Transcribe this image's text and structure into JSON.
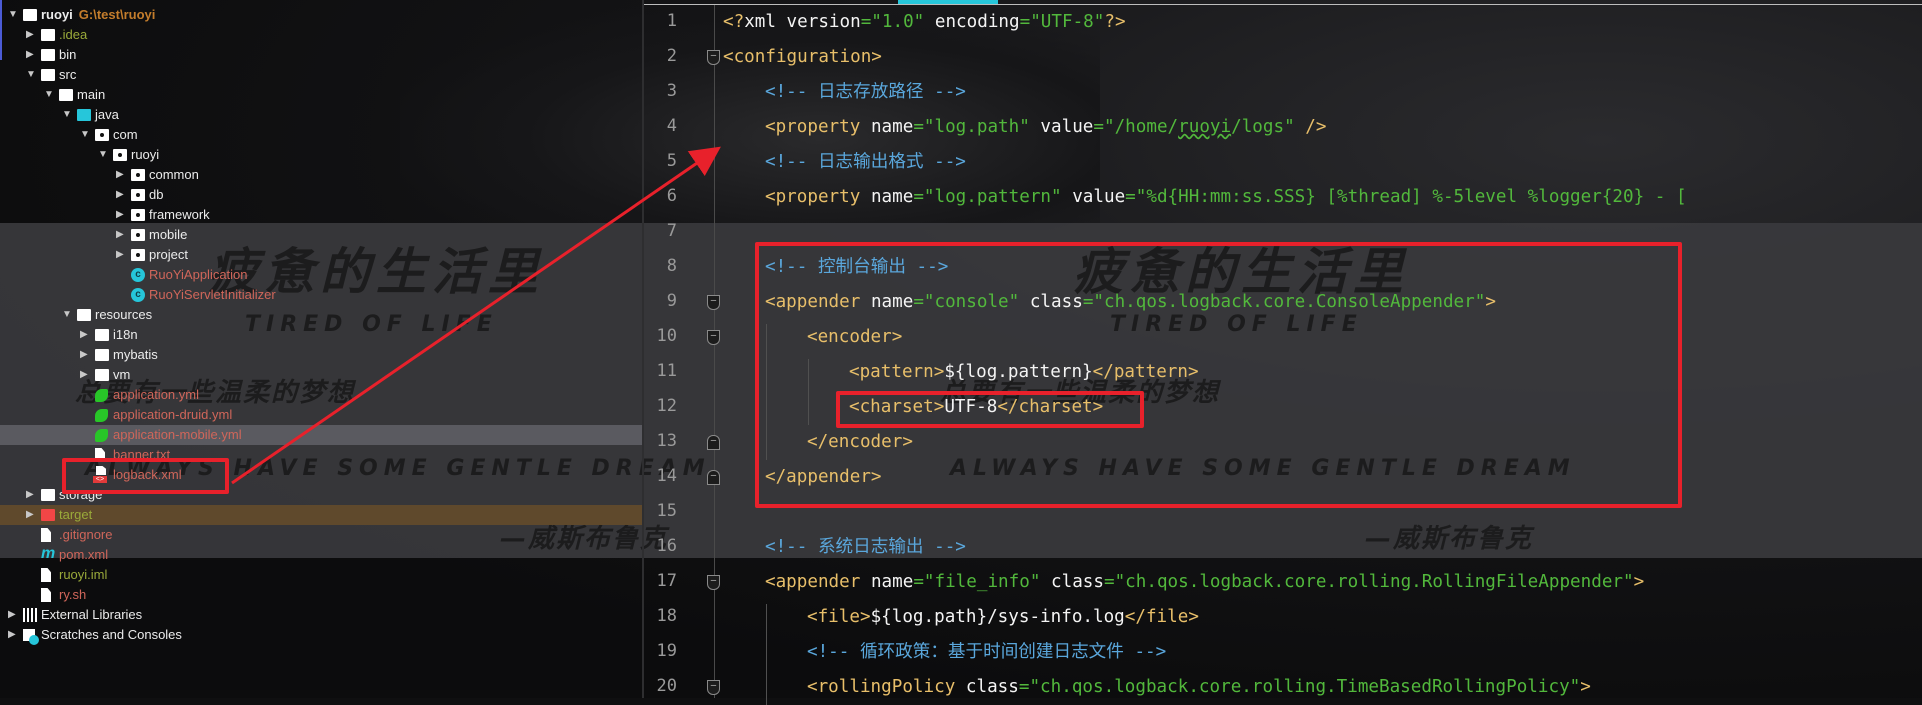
{
  "project_tree": {
    "rows": [
      {
        "label": "ruoyi",
        "extra": "G:\\test\\ruoyi",
        "level": 0,
        "arrow": "down",
        "icon": "module-folder",
        "color": "white",
        "bold": true
      },
      {
        "label": ".idea",
        "level": 1,
        "arrow": "right",
        "icon": "folder",
        "color": "olive"
      },
      {
        "label": "bin",
        "level": 1,
        "arrow": "right",
        "icon": "folder",
        "color": "white"
      },
      {
        "label": "src",
        "level": 1,
        "arrow": "down",
        "icon": "folder",
        "color": "white"
      },
      {
        "label": "main",
        "level": 2,
        "arrow": "down",
        "icon": "folder",
        "color": "white"
      },
      {
        "label": "java",
        "level": 3,
        "arrow": "down",
        "icon": "source-folder",
        "color": "white"
      },
      {
        "label": "com",
        "level": 4,
        "arrow": "down",
        "icon": "package",
        "color": "white"
      },
      {
        "label": "ruoyi",
        "level": 5,
        "arrow": "down",
        "icon": "package",
        "color": "white"
      },
      {
        "label": "common",
        "level": 6,
        "arrow": "right",
        "icon": "package",
        "color": "white"
      },
      {
        "label": "db",
        "level": 6,
        "arrow": "right",
        "icon": "package",
        "color": "white"
      },
      {
        "label": "framework",
        "level": 6,
        "arrow": "right",
        "icon": "package",
        "color": "white"
      },
      {
        "label": "mobile",
        "level": 6,
        "arrow": "right",
        "icon": "package",
        "color": "white"
      },
      {
        "label": "project",
        "level": 6,
        "arrow": "right",
        "icon": "package",
        "color": "white"
      },
      {
        "label": "RuoYiApplication",
        "level": 6,
        "arrow": "none",
        "icon": "spring-class",
        "color": "red"
      },
      {
        "label": "RuoYiServletInitializer",
        "level": 6,
        "arrow": "none",
        "icon": "class",
        "color": "red"
      },
      {
        "label": "resources",
        "level": 3,
        "arrow": "down",
        "icon": "resources-folder",
        "color": "white"
      },
      {
        "label": "i18n",
        "level": 4,
        "arrow": "right",
        "icon": "folder",
        "color": "white"
      },
      {
        "label": "mybatis",
        "level": 4,
        "arrow": "right",
        "icon": "folder",
        "color": "white"
      },
      {
        "label": "vm",
        "level": 4,
        "arrow": "right",
        "icon": "folder",
        "color": "white"
      },
      {
        "label": "application.yml",
        "level": 4,
        "arrow": "none",
        "icon": "yml",
        "color": "red"
      },
      {
        "label": "application-druid.yml",
        "level": 4,
        "arrow": "none",
        "icon": "yml",
        "color": "red"
      },
      {
        "label": "application-mobile.yml",
        "level": 4,
        "arrow": "none",
        "icon": "yml",
        "color": "red",
        "state": "hover"
      },
      {
        "label": "banner.txt",
        "level": 4,
        "arrow": "none",
        "icon": "text-file",
        "color": "red"
      },
      {
        "label": "logback.xml",
        "level": 4,
        "arrow": "none",
        "icon": "xml-file",
        "color": "red",
        "annotated": true
      },
      {
        "label": "storage",
        "level": 1,
        "arrow": "right",
        "icon": "folder",
        "color": "white"
      },
      {
        "label": "target",
        "level": 1,
        "arrow": "right",
        "icon": "excluded-folder",
        "color": "olive",
        "state": "excluded"
      },
      {
        "label": ".gitignore",
        "level": 1,
        "arrow": "none",
        "icon": "ignore-file",
        "color": "red"
      },
      {
        "label": "pom.xml",
        "level": 1,
        "arrow": "none",
        "icon": "maven",
        "color": "red"
      },
      {
        "label": "ruoyi.iml",
        "level": 1,
        "arrow": "none",
        "icon": "iml-file",
        "color": "olive"
      },
      {
        "label": "ry.sh",
        "level": 1,
        "arrow": "none",
        "icon": "shell-file",
        "color": "red"
      },
      {
        "label": "External Libraries",
        "level": 0,
        "arrow": "right",
        "icon": "libraries",
        "color": "white"
      },
      {
        "label": "Scratches and Consoles",
        "level": 0,
        "arrow": "right",
        "icon": "scratches",
        "color": "white"
      }
    ]
  },
  "editor": {
    "lines": [
      {
        "n": "1",
        "indent": 0,
        "tokens": [
          [
            "tg",
            "<?"
          ],
          [
            "an",
            "xml version"
          ],
          [
            "av",
            "=\"1.0\""
          ],
          [
            "an",
            " encoding"
          ],
          [
            "av",
            "=\"UTF-8\""
          ],
          [
            "tg",
            "?>"
          ]
        ]
      },
      {
        "n": "2",
        "indent": 0,
        "fold": "open",
        "tokens": [
          [
            "tg",
            "<configuration>"
          ]
        ]
      },
      {
        "n": "3",
        "indent": 1,
        "tokens": [
          [
            "cm",
            "<!-- 日志存放路径 -->"
          ]
        ]
      },
      {
        "n": "4",
        "indent": 1,
        "tokens": [
          [
            "tg",
            "<property "
          ],
          [
            "an",
            "name"
          ],
          [
            "av",
            "=\"log.path\" "
          ],
          [
            "an",
            "value"
          ],
          [
            "av",
            "=\"/home/"
          ],
          [
            "av squig",
            "ruoyi"
          ],
          [
            "av",
            "/logs\" "
          ],
          [
            "tg",
            "/>"
          ]
        ]
      },
      {
        "n": "5",
        "indent": 1,
        "tokens": [
          [
            "cm",
            "<!-- 日志输出格式 -->"
          ]
        ]
      },
      {
        "n": "6",
        "indent": 1,
        "tokens": [
          [
            "tg",
            "<property "
          ],
          [
            "an",
            "name"
          ],
          [
            "av",
            "=\"log.pattern\" "
          ],
          [
            "an",
            "value"
          ],
          [
            "av",
            "=\"%d{HH:mm:ss.SSS} [%thread] %-5level %logger{20} - ["
          ]
        ]
      },
      {
        "n": "7",
        "indent": 0,
        "tokens": []
      },
      {
        "n": "8",
        "indent": 1,
        "tokens": [
          [
            "cm",
            "<!-- 控制台输出 -->"
          ]
        ]
      },
      {
        "n": "9",
        "indent": 1,
        "fold": "open",
        "tokens": [
          [
            "tg",
            "<appender "
          ],
          [
            "an",
            "name"
          ],
          [
            "av",
            "=\"console\" "
          ],
          [
            "an",
            "class"
          ],
          [
            "av",
            "=\"ch.qos.logback.core.ConsoleAppender\""
          ],
          [
            "tg",
            ">"
          ]
        ]
      },
      {
        "n": "10",
        "indent": 2,
        "fold": "open",
        "tokens": [
          [
            "tg",
            "<encoder>"
          ]
        ]
      },
      {
        "n": "11",
        "indent": 3,
        "tokens": [
          [
            "tg",
            "<pattern>"
          ],
          [
            "tx",
            "${log.pattern}"
          ],
          [
            "tg",
            "</pattern>"
          ]
        ]
      },
      {
        "n": "12",
        "indent": 3,
        "tokens": [
          [
            "tg",
            "<charset>"
          ],
          [
            "tx",
            "UTF-8"
          ],
          [
            "tg",
            "</charset>"
          ]
        ]
      },
      {
        "n": "13",
        "indent": 2,
        "fold": "close",
        "tokens": [
          [
            "tg",
            "</encoder>"
          ]
        ]
      },
      {
        "n": "14",
        "indent": 1,
        "fold": "close",
        "tokens": [
          [
            "tg",
            "</appender>"
          ]
        ]
      },
      {
        "n": "15",
        "indent": 0,
        "tokens": []
      },
      {
        "n": "16",
        "indent": 1,
        "tokens": [
          [
            "cm",
            "<!-- 系统日志输出 -->"
          ]
        ]
      },
      {
        "n": "17",
        "indent": 1,
        "fold": "open",
        "tokens": [
          [
            "tg",
            "<appender "
          ],
          [
            "an",
            "name"
          ],
          [
            "av",
            "=\"file_info\" "
          ],
          [
            "an",
            "class"
          ],
          [
            "av",
            "=\"ch.qos.logback.core.rolling.RollingFileAppender\""
          ],
          [
            "tg",
            ">"
          ]
        ]
      },
      {
        "n": "18",
        "indent": 2,
        "tokens": [
          [
            "tg",
            "<file>"
          ],
          [
            "tx",
            "${log.path}/sys-info.log"
          ],
          [
            "tg",
            "</file>"
          ]
        ]
      },
      {
        "n": "19",
        "indent": 2,
        "tokens": [
          [
            "cm",
            "<!-- 循环政策：基于时间创建日志文件 -->"
          ]
        ]
      },
      {
        "n": "20",
        "indent": 2,
        "fold": "open",
        "tokens": [
          [
            "tg",
            "<rollingPolicy "
          ],
          [
            "an",
            "class"
          ],
          [
            "av",
            "=\"ch.qos.logback.core.rolling.TimeBasedRollingPolicy\""
          ],
          [
            "tg",
            ">"
          ]
        ]
      }
    ]
  },
  "wallpaper": {
    "line1": "疲惫的生活里",
    "line1_en": "TIRED OF LIFE",
    "line2": "总要有一些温柔的梦想",
    "line2_en": "ALWAYS HAVE SOME GENTLE DREAM",
    "author": "—威斯布鲁克"
  },
  "colors": {
    "annotation_red": "#e8212b",
    "accent": "#26c6da"
  }
}
